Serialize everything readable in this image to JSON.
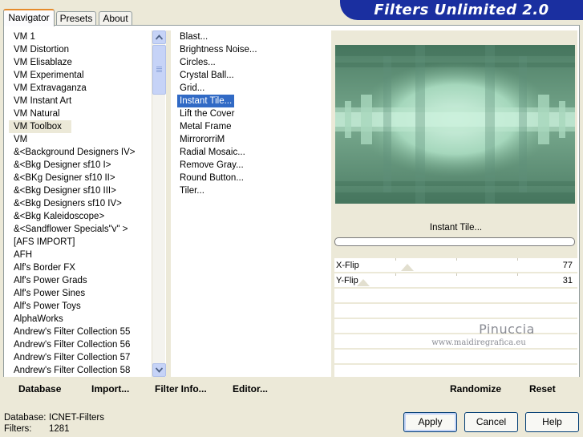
{
  "app": {
    "title": "Filters Unlimited 2.0"
  },
  "tabs": [
    {
      "label": "Navigator",
      "active": true
    },
    {
      "label": "Presets",
      "active": false
    },
    {
      "label": "About",
      "active": false
    }
  ],
  "categories": [
    "VM 1",
    "VM Distortion",
    "VM Elisablaze",
    "VM Experimental",
    "VM Extravaganza",
    "VM Instant Art",
    "VM Natural",
    "VM Toolbox",
    "VM",
    "&<Background Designers IV>",
    "&<Bkg Designer sf10 I>",
    "&<BKg Designer sf10 II>",
    "&<Bkg Designer sf10 III>",
    "&<Bkg Designers sf10 IV>",
    "&<Bkg Kaleidoscope>",
    "&<Sandflower Specials\"v\" >",
    "[AFS IMPORT]",
    "AFH",
    "Alf's Border FX",
    "Alf's Power Grads",
    "Alf's Power Sines",
    "Alf's Power Toys",
    "AlphaWorks",
    "Andrew's Filter Collection 55",
    "Andrew's Filter Collection 56",
    "Andrew's Filter Collection 57",
    "Andrew's Filter Collection 58"
  ],
  "selected_category": "VM Toolbox",
  "filters": [
    "Blast...",
    "Brightness Noise...",
    "Circles...",
    "Crystal Ball...",
    "Grid...",
    "Instant Tile...",
    "Lift the Cover",
    "Metal Frame",
    "MirrororriM",
    "Radial Mosaic...",
    "Remove Gray...",
    "Round Button...",
    "Tiler..."
  ],
  "selected_filter": "Instant Tile...",
  "params": {
    "filter_name": "Instant Tile...",
    "sliders": [
      {
        "label": "X-Flip",
        "value": 77,
        "max": 255
      },
      {
        "label": "Y-Flip",
        "value": 31,
        "max": 255
      }
    ]
  },
  "watermark": {
    "line1": "Pinuccia",
    "line2": "www.maidiregrafica.eu"
  },
  "bottom_buttons": {
    "database": "Database",
    "import": "Import...",
    "filter_info": "Filter Info...",
    "editor": "Editor...",
    "randomize": "Randomize",
    "reset": "Reset"
  },
  "status": {
    "database_label": "Database:",
    "database_value": "ICNET-Filters",
    "filters_label": "Filters:",
    "filters_value": "1281"
  },
  "dialog_buttons": {
    "apply": "Apply",
    "cancel": "Cancel",
    "help": "Help"
  },
  "colors": {
    "banner": "#1a2fa0",
    "selection": "#316AC5",
    "preview_dark": "#4F7F67",
    "preview_light": "#BFE9D2"
  }
}
